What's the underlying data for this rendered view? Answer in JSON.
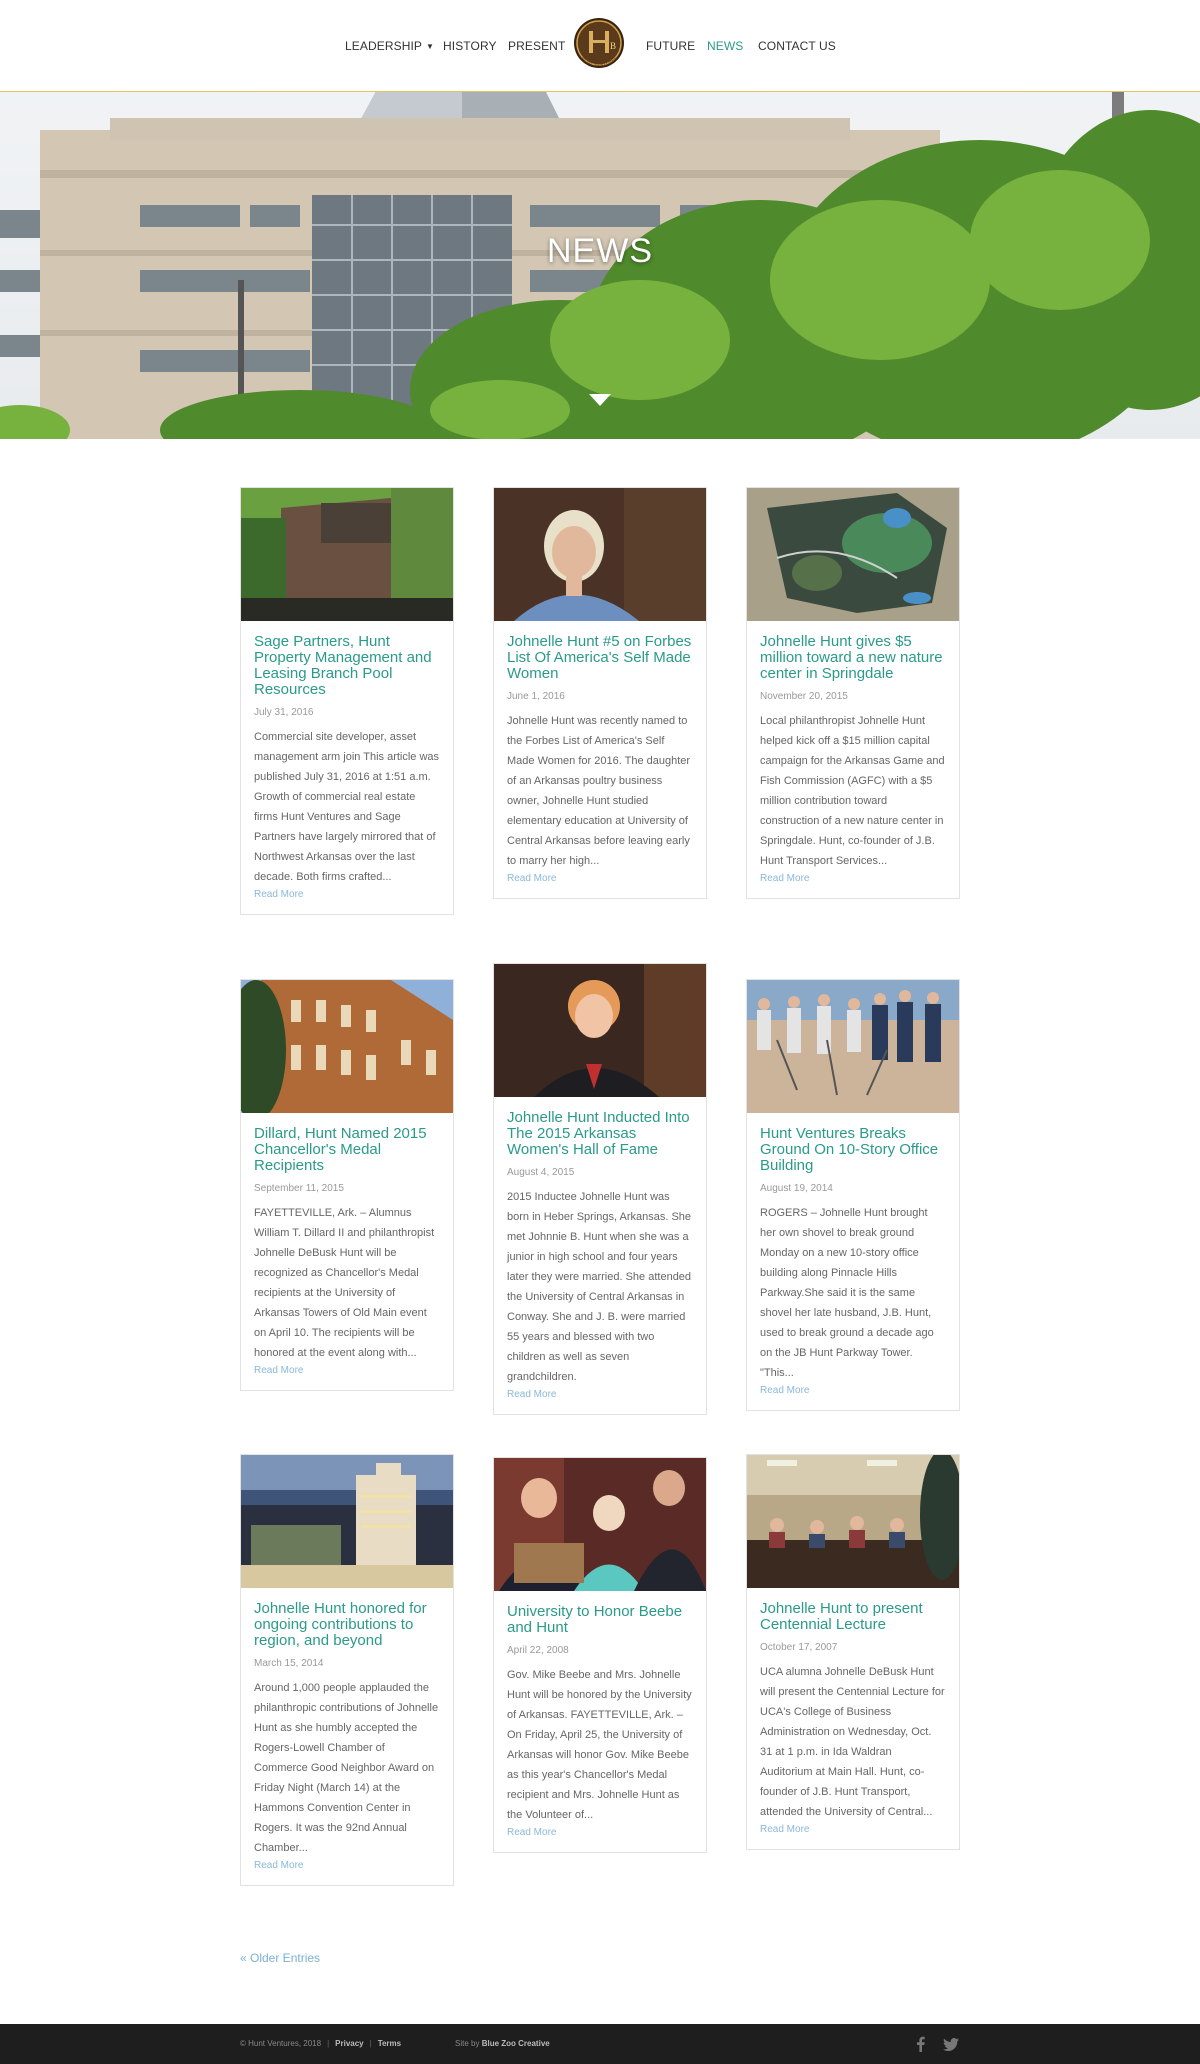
{
  "nav": {
    "leadership": "LEADERSHIP",
    "history": "HISTORY",
    "present": "PRESENT",
    "future": "FUTURE",
    "news": "NEWS",
    "contact": "CONTACT US",
    "logo_text": "HUNT VENTURES",
    "logo_monogram": "JHB"
  },
  "hero": {
    "title": "NEWS"
  },
  "posts": [
    {
      "title": "Sage Partners, Hunt Property Management and Leasing Branch Pool Resources",
      "date": "July 31, 2016",
      "excerpt": "Commercial site developer, asset management arm join This article was published July 31, 2016 at 1:51 a.m. Growth of commercial real estate firms Hunt Ventures and Sage Partners have largely mirrored that of Northwest Arkansas over the last decade. Both firms crafted...",
      "more": "Read More"
    },
    {
      "title": "Johnelle Hunt #5 on Forbes List Of America's Self Made Women",
      "date": "June 1, 2016",
      "excerpt": "Johnelle Hunt was recently named to the Forbes List of America's Self Made Women for 2016. The daughter of an Arkansas poultry business owner, Johnelle Hunt studied elementary education at University of Central Arkansas before leaving early to marry her high...",
      "more": "Read More"
    },
    {
      "title": "Johnelle Hunt gives $5 million toward a new nature center in Springdale",
      "date": "November 20, 2015",
      "excerpt": "Local philanthropist Johnelle Hunt helped kick off a $15 million capital campaign for the Arkansas Game and Fish Commission (AGFC) with a $5 million contribution toward construction of a new nature center in Springdale. Hunt, co-founder of J.B. Hunt Transport Services...",
      "more": "Read More"
    },
    {
      "title": "Dillard, Hunt Named 2015 Chancellor's Medal Recipients",
      "date": "September 11, 2015",
      "excerpt": "FAYETTEVILLE, Ark. – Alumnus William T. Dillard II and philanthropist Johnelle DeBusk Hunt will be recognized as Chancellor's Medal recipients at the University of Arkansas Towers of Old Main event on April 10. The recipients will be honored at the event along with...",
      "more": "Read More"
    },
    {
      "title": "Johnelle Hunt Inducted Into The 2015 Arkansas Women's Hall of Fame",
      "date": "August 4, 2015",
      "excerpt": "2015 Inductee Johnelle Hunt was born in Heber Springs, Arkansas. She met Johnnie B. Hunt when she was a junior in high school and four years later they were married. She attended the University of Central Arkansas in Conway. She and J. B. were married 55 years and blessed with two children as well as seven grandchildren.",
      "more": "Read More"
    },
    {
      "title": "Hunt Ventures Breaks Ground On 10-Story Office Building",
      "date": "August 19, 2014",
      "excerpt": "ROGERS – Johnelle Hunt brought her own shovel to break ground Monday on a new 10-story office building along Pinnacle Hills Parkway.She said it is the same shovel her late husband, J.B. Hunt, used to break ground a decade ago on the JB Hunt Parkway Tower. \"This...",
      "more": "Read More"
    },
    {
      "title": "Johnelle Hunt honored for ongoing contributions to region, and beyond",
      "date": "March 15, 2014",
      "excerpt": "Around 1,000 people applauded the philanthropic contributions of Johnelle Hunt as she humbly accepted the Rogers-Lowell Chamber of Commerce Good Neighbor Award on Friday Night (March 14) at the Hammons Convention Center in Rogers. It was the 92nd Annual Chamber...",
      "more": "Read More"
    },
    {
      "title": "University to Honor Beebe and Hunt",
      "date": "April 22, 2008",
      "excerpt": "Gov. Mike Beebe and Mrs. Johnelle Hunt will be honored by the University of Arkansas. FAYETTEVILLE, Ark. – On Friday, April 25, the University of Arkansas will honor Gov. Mike Beebe as this year's Chancellor's Medal recipient and Mrs. Johnelle Hunt as the Volunteer of...",
      "more": "Read More"
    },
    {
      "title": "Johnelle Hunt to present Centennial Lecture",
      "date": "October 17, 2007",
      "excerpt": "UCA alumna Johnelle DeBusk Hunt will present the Centennial Lecture for UCA's College of Business Administration on Wednesday, Oct. 31 at 1 p.m. in Ida Waldran Auditorium at Main Hall. Hunt, co-founder of J.B. Hunt Transport, attended the University of Central...",
      "more": "Read More"
    }
  ],
  "pagination": {
    "older": "« Older Entries"
  },
  "footer": {
    "copyright": "© Hunt Ventures, 2018",
    "privacy": "Privacy",
    "terms": "Terms",
    "site_by": "Site by",
    "agency": "Blue Zoo Creative"
  },
  "colors": {
    "accent": "#2a9a8a",
    "link": "#8ab8d8",
    "gold_rule": "#e6c35a",
    "footer_bg": "#1e1e1e"
  }
}
